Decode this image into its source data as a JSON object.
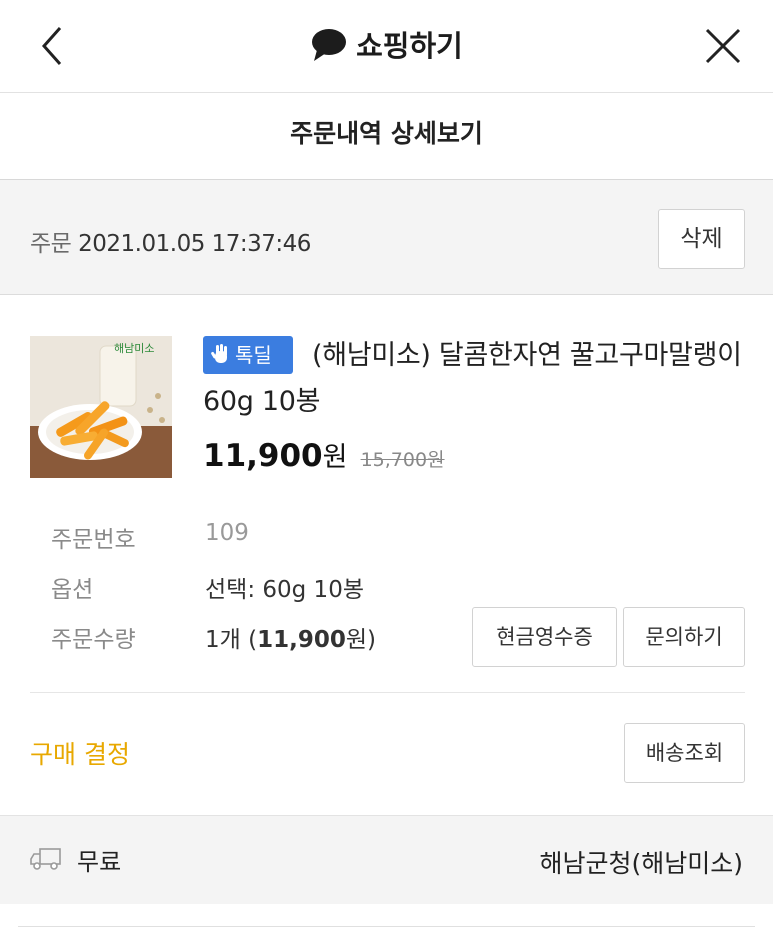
{
  "header": {
    "title": "쇼핑하기",
    "back_icon": "chevron-left-icon",
    "close_icon": "close-icon"
  },
  "subtitle": "주문내역 상세보기",
  "order": {
    "label": "주문",
    "datetime": "2021.01.05 17:37:46",
    "delete_label": "삭제"
  },
  "product": {
    "badge_label": "톡딜",
    "name": "(해남미소) 달콤한자연 꿀고구마말랭이 60g 10봉",
    "price": "11,900",
    "price_unit": "원",
    "original_price": "15,700원",
    "thumb_brand": "해남미소"
  },
  "info": {
    "order_number_label": "주문번호",
    "order_number": "109",
    "option_label": "옵션",
    "option_value": "선택: 60g 10봉",
    "quantity_label": "주문수량",
    "quantity_prefix": "1개 (",
    "quantity_amount": "11,900",
    "quantity_suffix": "원)"
  },
  "buttons": {
    "receipt": "현금영수증",
    "inquiry": "문의하기",
    "tracking": "배송조회"
  },
  "purchase_decision": "구매 결정",
  "shipping": {
    "fee": "무료",
    "seller": "해남군청(해남미소)"
  },
  "colors": {
    "accent_yellow": "#e8a800",
    "badge_blue": "#3b7de0"
  }
}
